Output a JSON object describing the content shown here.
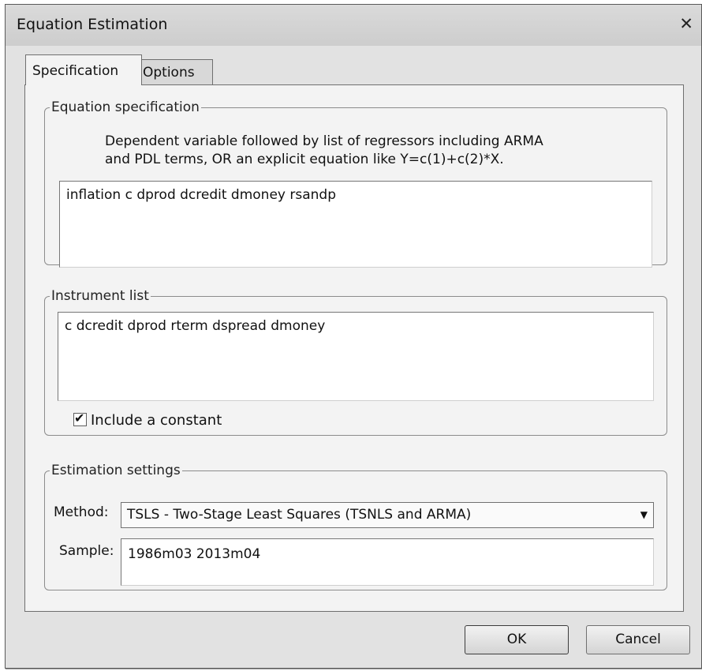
{
  "window": {
    "title": "Equation Estimation",
    "close_icon": "close-icon"
  },
  "tabs": [
    {
      "label": "Specification",
      "active": true
    },
    {
      "label": "Options",
      "active": false
    }
  ],
  "equation_specification": {
    "legend": "Equation specification",
    "description_line1": "Dependent variable followed by list of regressors including ARMA",
    "description_line2": "and PDL terms, OR an explicit equation like Y=c(1)+c(2)*X.",
    "value": "inflation c dprod dcredit dmoney rsandp"
  },
  "instrument_list": {
    "legend": "Instrument list",
    "value": "c dcredit dprod rterm dspread dmoney",
    "include_constant_label": "Include a constant",
    "include_constant_checked": true
  },
  "estimation_settings": {
    "legend": "Estimation settings",
    "method_label": "Method:",
    "method_value": "TSLS  -  Two-Stage Least Squares (TSNLS and ARMA)",
    "sample_label": "Sample:",
    "sample_value": "1986m03 2013m04"
  },
  "buttons": {
    "ok": "OK",
    "cancel": "Cancel"
  }
}
